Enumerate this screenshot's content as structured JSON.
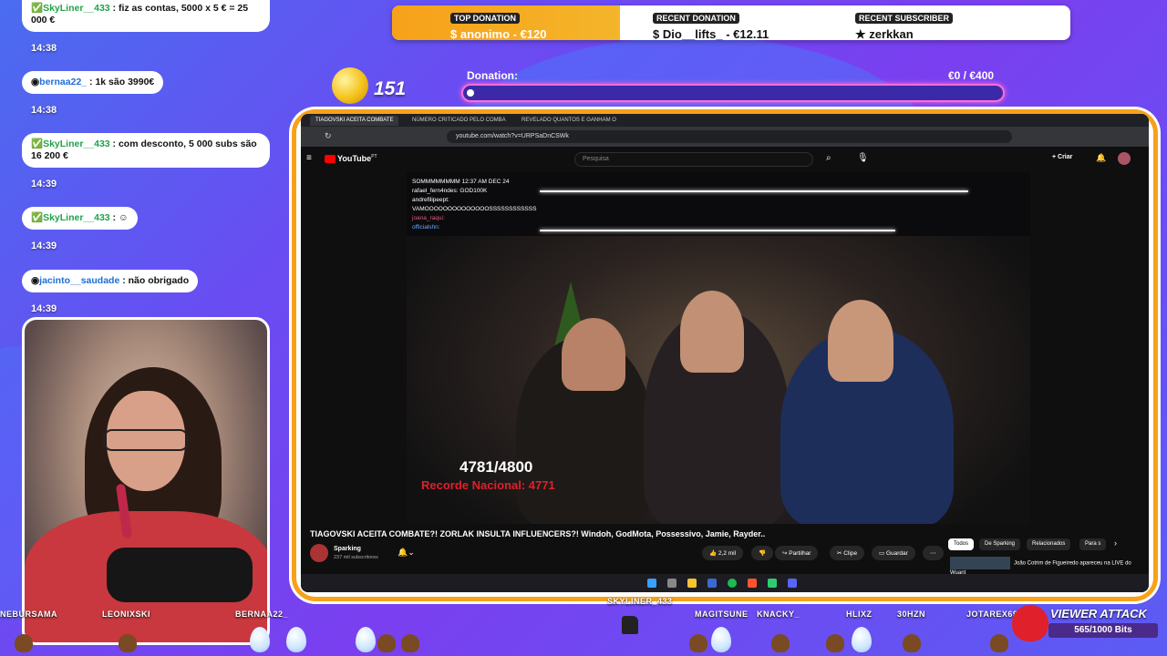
{
  "chat": [
    {
      "user": "SkyLiner__433",
      "text": " : fiz as contas, 5000 x 5 € = 25 000 €",
      "time": "14:38"
    },
    {
      "user": "bernaa22_",
      "text": " : 1k são 3990€",
      "time": "14:38"
    },
    {
      "user": "SkyLiner__433",
      "text": " : com desconto, 5 000 subs são 16 200 €",
      "time": "14:39"
    },
    {
      "user": "SkyLiner__433",
      "text": " : ",
      "time": "14:39"
    },
    {
      "user": "jacinto__saudade",
      "text": " : não obrigado",
      "time": "14:39"
    }
  ],
  "topbar": {
    "top_donation_label": "TOP DONATION",
    "top_donation_value": "$ anonimo - €120",
    "recent_donation_label": "RECENT DONATION",
    "recent_donation_value": "$ Dio__lifts_ - €12.11",
    "recent_sub_label": "RECENT SUBSCRIBER",
    "recent_sub_value": "★ zerkkan"
  },
  "goal": {
    "count": "151",
    "label": "Donation:",
    "amount": "€0 / €400",
    "progress": 0.0
  },
  "browser": {
    "tabs": [
      "TIAGOVSKI ACEITA COMBATE",
      "NÚMERO CRITICADO PELO COMBA",
      "REVELADO QUANTOS E GANHAM O"
    ],
    "url": "youtube.com/watch?v=URPSaDnCSWk",
    "yt_logo": "YouTube",
    "yt_logo_sup": "PT",
    "search_placeholder": "Pesquisa",
    "create_label": "+ Criar"
  },
  "video": {
    "overlay_chat": [
      "SOMMMMMMMM 12:37 AM DEC 24",
      "rafael_fern4ndes: GOD100K",
      "andrefilipeept:",
      "VAMOOOOOOOOOOOOOOSSSSSSSSSSSS",
      "joana_raqui:",
      "officialshn:"
    ],
    "score": "4781/4800",
    "record": "Recorde Nacional: 4771"
  },
  "yt": {
    "title": "TIAGOVSKI ACEITA COMBATE?! ZORLAK INSULTA INFLUENCERS?! Windoh, GodMota, Possessivo, Jamie, Rayder..",
    "channel": "Sparking",
    "subs": "237 mil subscritores",
    "likes": "2,2 mil",
    "share": "Partilhar",
    "clip": "Clipe",
    "save": "Guardar",
    "chips": [
      "Todos",
      "De Sparking",
      "Relacionados",
      "Para s"
    ],
    "related": "João Cotrim de Figueiredo apareceu na LIVE do Wuant"
  },
  "bottom_names": [
    "NEBURSAMA",
    "LEONIXSKI",
    "BERNAA22_",
    "SKYLINER_433",
    "MAGITSUNE",
    "KNACKY_",
    "HLIXZ",
    "30HZN",
    "JOTAREX69"
  ],
  "viewer_attack": {
    "title": "VIEWER ATTACK",
    "bits": "565/1000 Bits",
    "progress": 0.565
  }
}
